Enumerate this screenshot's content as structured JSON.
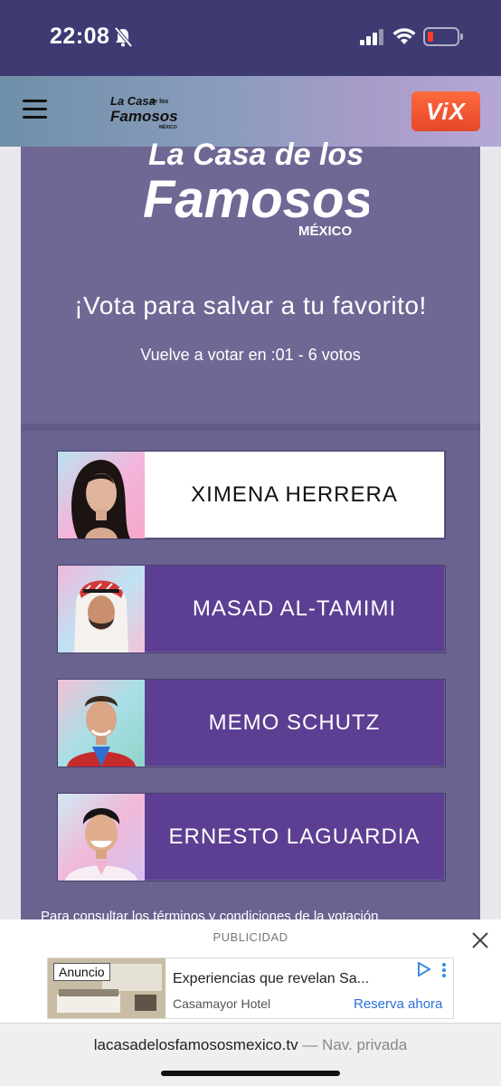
{
  "status_bar": {
    "time": "22:08"
  },
  "header": {
    "logo_text": "La Casa de los Famosos",
    "vix_label": "ViX"
  },
  "hero": {
    "logo_lines": [
      "La Casa de los",
      "Famosos",
      "MÉXICO"
    ],
    "title": "¡Vota para salvar a tu favorito!",
    "subtitle": "Vuelve a votar en :01 - 6 votos"
  },
  "candidates": [
    {
      "name": "XIMENA HERRERA",
      "selected": true
    },
    {
      "name": "MASAD AL-TAMIMI",
      "selected": false
    },
    {
      "name": "MEMO SCHUTZ",
      "selected": false
    },
    {
      "name": "ERNESTO LAGUARDIA",
      "selected": false
    }
  ],
  "terms_text": "Para consultar los términos y condiciones de la votación",
  "ad": {
    "label": "PUBLICIDAD",
    "badge": "Anuncio",
    "title": "Experiencias que revelan Sa...",
    "brand": "Casamayor Hotel",
    "cta": "Reserva ahora"
  },
  "browser": {
    "url": "lacasadelosfamososmexico.tv",
    "separator": "—",
    "mode": "Nav. privada"
  },
  "colors": {
    "status_bg": "#3e3a72",
    "panel_bg": "#6a628f",
    "candidate_bg": "#5c3f93",
    "vix": "#e5472b"
  }
}
